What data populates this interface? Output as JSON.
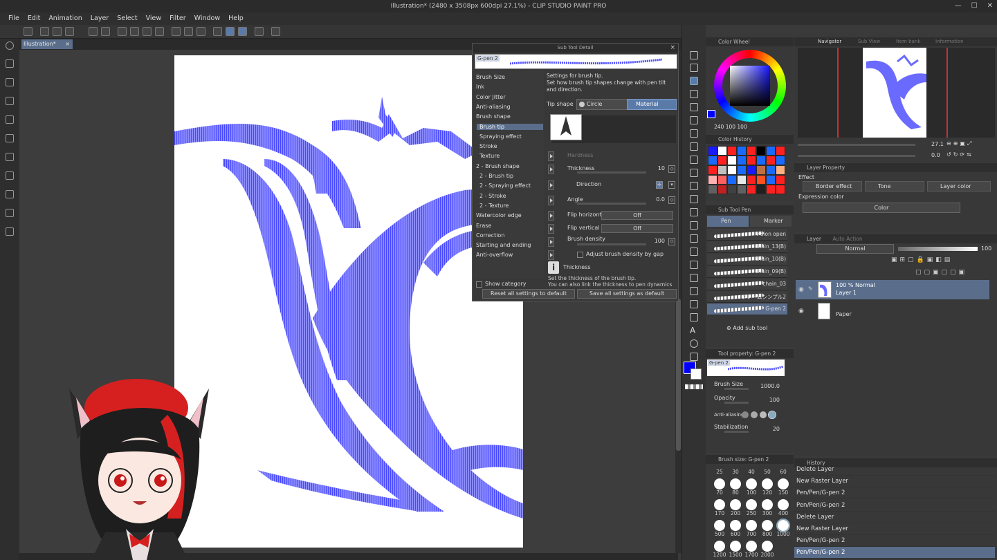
{
  "window": {
    "title": "Illustration* (2480 x 3508px 600dpi 27.1%) - CLIP STUDIO PAINT PRO"
  },
  "menu": [
    "File",
    "Edit",
    "Animation",
    "Layer",
    "Select",
    "View",
    "Filter",
    "Window",
    "Help"
  ],
  "document": {
    "tab": "Illustration*",
    "tab_close": "×"
  },
  "colors": {
    "accent": "#5a6e8c",
    "brush_stroke": "#1a1aff",
    "foreground": "#0000ff",
    "background": "#ffffff"
  },
  "sub_tool_detail": {
    "title": "Sub Tool Detail",
    "close": "×",
    "brush_name": "G-pen 2",
    "categories": [
      {
        "label": "Brush Size",
        "sub": false
      },
      {
        "label": "Ink",
        "sub": false
      },
      {
        "label": "Color Jitter",
        "sub": false
      },
      {
        "label": "Anti-aliasing",
        "sub": false
      },
      {
        "label": "Brush shape",
        "sub": false
      },
      {
        "label": "Brush tip",
        "sub": true
      },
      {
        "label": "Spraying effect",
        "sub": true
      },
      {
        "label": "Stroke",
        "sub": true
      },
      {
        "label": "Texture",
        "sub": true
      },
      {
        "label": "2 - Brush shape",
        "sub": false
      },
      {
        "label": "2 - Brush tip",
        "sub": true
      },
      {
        "label": "2 - Spraying effect",
        "sub": true
      },
      {
        "label": "2 - Stroke",
        "sub": true
      },
      {
        "label": "2 - Texture",
        "sub": true
      },
      {
        "label": "Watercolor edge",
        "sub": false
      },
      {
        "label": "Erase",
        "sub": false
      },
      {
        "label": "Correction",
        "sub": false
      },
      {
        "label": "Starting and ending",
        "sub": false
      },
      {
        "label": "Anti-overflow",
        "sub": false
      }
    ],
    "selected_category": "Brush tip",
    "description_line1": "Settings for brush tip.",
    "description_line2": "Set how brush tip shapes change with pen tilt and direction.",
    "tip_shape_label": "Tip shape",
    "tip_circle": "Circle",
    "tip_material": "Material",
    "hardness_label": "Hardness",
    "thickness_label": "Thickness",
    "thickness_value": "10",
    "direction_label": "Direction",
    "angle_label": "Angle",
    "angle_value": "0.0",
    "flip_h_label": "Flip horizontal",
    "flip_h_value": "Off",
    "flip_v_label": "Flip vertical",
    "flip_v_value": "Off",
    "density_label": "Brush density",
    "density_value": "100",
    "adjust_gap_label": "Adjust brush density by gap",
    "help_title": "Thickness",
    "help_line1": "Set the thickness of the brush tip.",
    "help_line2": "You can also link the thickness to pen dynamics",
    "show_category": "Show category",
    "reset_button": "Reset all settings to default",
    "save_button": "Save all settings as default"
  },
  "color_wheel": {
    "title": "Color Wheel",
    "values": "240 100 100"
  },
  "color_history": {
    "title": "Color History",
    "swatches": [
      "#1a1aff",
      "#ffffff",
      "#ff2020",
      "#1a6aff",
      "#ff2020",
      "#000000",
      "#1a6aff",
      "#ff2020",
      "#1a6aff",
      "#ff2020",
      "#ffffff",
      "#1a6aff",
      "#ff2020",
      "#1a6aff",
      "#ff2020",
      "#1a6aff",
      "#ff2020",
      "#c0c0c0",
      "#ffffff",
      "#1a6aff",
      "#1a1aff",
      "#c07040",
      "#1a6aff",
      "#ffb080",
      "#ffb0b0",
      "#ff6060",
      "#1a6aff",
      "#e8e8e8",
      "#ff2020",
      "#ff5020",
      "#1a6aff",
      "#ff2020",
      "#606060",
      "#c02020",
      "#404040",
      "#606060",
      "#ff2020",
      "#202020",
      "#ff2020",
      "#ff2020"
    ]
  },
  "sub_tool": {
    "title": "Sub Tool Pen",
    "tabs": [
      "Pen",
      "Marker"
    ],
    "brushes": [
      "vision open",
      "chain_13(B)",
      "chain_10(B)",
      "chain_09(B)",
      "chain_03",
      "フレームシンプル2",
      "G-pen 2"
    ],
    "add_label": "Add sub tool"
  },
  "tool_property": {
    "title": "Tool property: G-pen 2",
    "brush_name": "G-pen 2",
    "brush_size_label": "Brush Size",
    "brush_size_value": "1000.0",
    "opacity_label": "Opacity",
    "opacity_value": "100",
    "aa_label": "Anti-aliasing",
    "stab_label": "Stabilization",
    "stab_value": "20"
  },
  "brush_size": {
    "title": "Brush size: G-pen 2",
    "top_labels": [
      "25",
      "30",
      "40",
      "50",
      "60"
    ],
    "rows": [
      [
        "70",
        "80",
        "100",
        "120",
        "150"
      ],
      [
        "170",
        "200",
        "250",
        "300",
        "400"
      ],
      [
        "500",
        "600",
        "700",
        "800",
        "1000"
      ],
      [
        "1200",
        "1500",
        "1700",
        "2000"
      ]
    ]
  },
  "navigator": {
    "tabs": [
      "Navigator",
      "Sub View",
      "Item bank",
      "Information"
    ],
    "zoom": "27.1",
    "rotation": "0.0"
  },
  "layer_property": {
    "title": "Layer Property",
    "effect_label": "Effect",
    "border_effect": "Border effect",
    "tone": "Tone",
    "layer_color": "Layer color",
    "expression_label": "Expression color",
    "expression_value": "Color"
  },
  "layer": {
    "tabs": [
      "Layer",
      "Auto Action"
    ],
    "blend": "Normal",
    "opacity": "100",
    "layers": [
      {
        "line1": "100 % Normal",
        "line2": "Layer 1",
        "selected": true
      },
      {
        "line1": "",
        "line2": "Paper",
        "selected": false
      }
    ]
  },
  "history": {
    "title": "History",
    "items": [
      "Delete Layer",
      "New Raster Layer",
      "Pen/Pen/G-pen 2",
      "Pen/Pen/G-pen 2",
      "Delete Layer",
      "New Raster Layer",
      "Pen/Pen/G-pen 2",
      "Pen/Pen/G-pen 2"
    ]
  }
}
